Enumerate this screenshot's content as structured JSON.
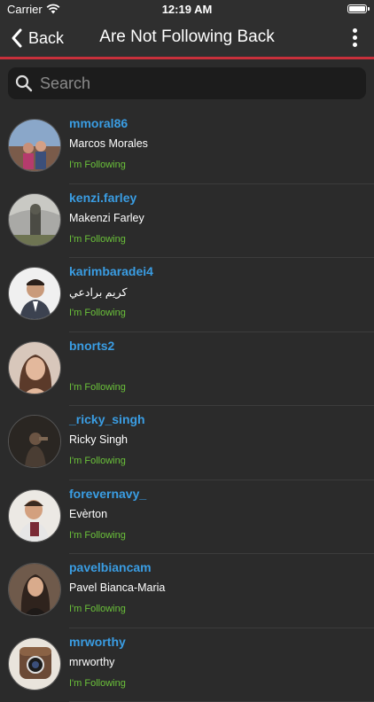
{
  "status_bar": {
    "carrier": "Carrier",
    "time": "12:19 AM"
  },
  "nav": {
    "back_label": "Back",
    "title": "Are Not Following Back"
  },
  "search": {
    "placeholder": "Search"
  },
  "colors": {
    "accent_red": "#c8303b",
    "username_blue": "#3a9de3",
    "following_green": "#6bc23a"
  },
  "users": [
    {
      "username": "mmoral86",
      "full_name": "Marcos Morales",
      "status": "I'm Following",
      "avatar": "avatar-photo"
    },
    {
      "username": "kenzi.farley",
      "full_name": "Makenzi Farley",
      "status": "I'm Following",
      "avatar": "avatar-photo"
    },
    {
      "username": "karimbaradei4",
      "full_name": "كريم برادعي",
      "status": "I'm Following",
      "avatar": "avatar-photo"
    },
    {
      "username": "bnorts2",
      "full_name": "",
      "status": "I'm Following",
      "avatar": "avatar-photo"
    },
    {
      "username": "_ricky_singh",
      "full_name": "Ricky Singh",
      "status": "I'm Following",
      "avatar": "avatar-photo"
    },
    {
      "username": "forevernavy_",
      "full_name": "Evèrton",
      "status": "I'm Following",
      "avatar": "avatar-photo"
    },
    {
      "username": "pavelbiancam",
      "full_name": "Pavel Bianca-Maria",
      "status": "I'm Following",
      "avatar": "avatar-photo"
    },
    {
      "username": "mrworthy",
      "full_name": "mrworthy",
      "status": "I'm Following",
      "avatar": "instagram-default-icon"
    }
  ]
}
